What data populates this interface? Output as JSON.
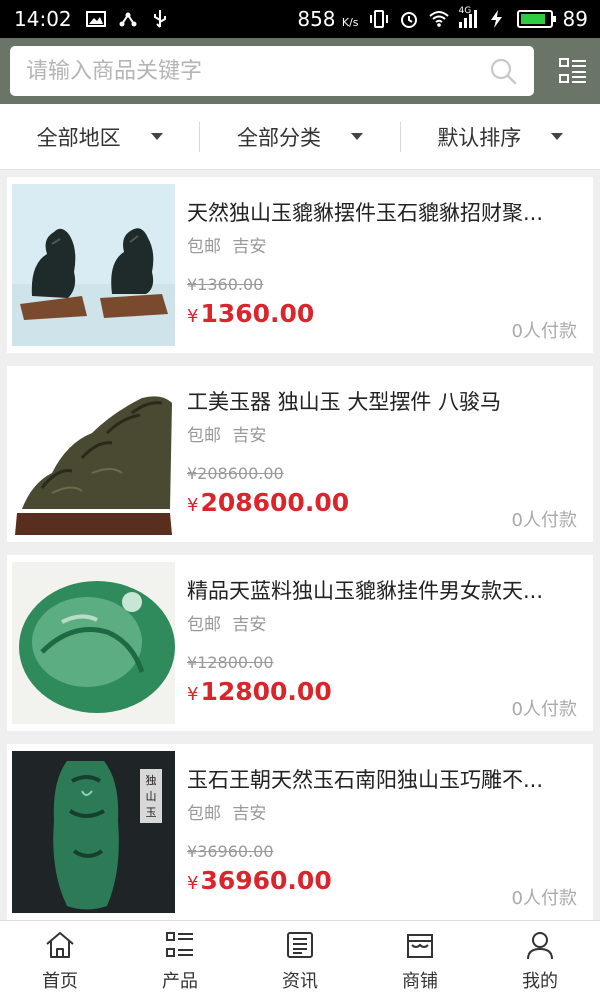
{
  "status": {
    "time": "14:02",
    "speed_value": "858",
    "speed_unit": "K/s",
    "network": "4G",
    "battery": "89",
    "battery_level": 0.89
  },
  "search": {
    "placeholder": "请输入商品关键字",
    "value": ""
  },
  "filters": [
    {
      "label": "全部地区"
    },
    {
      "label": "全部分类"
    },
    {
      "label": "默认排序"
    }
  ],
  "products": [
    {
      "title": "天然独山玉貔貅摆件玉石貔貅招财聚...",
      "shipping": "包邮",
      "location": "吉安",
      "old_price": "¥1360.00",
      "currency": "¥",
      "price": "1360.00",
      "paid": "0人付款"
    },
    {
      "title": "工美玉器 独山玉 大型摆件 八骏马",
      "shipping": "包邮",
      "location": "吉安",
      "old_price": "¥208600.00",
      "currency": "¥",
      "price": "208600.00",
      "paid": "0人付款"
    },
    {
      "title": "精品天蓝料独山玉貔貅挂件男女款天...",
      "shipping": "包邮",
      "location": "吉安",
      "old_price": "¥12800.00",
      "currency": "¥",
      "price": "12800.00",
      "paid": "0人付款"
    },
    {
      "title": "玉石王朝天然玉石南阳独山玉巧雕不...",
      "shipping": "包邮",
      "location": "吉安",
      "old_price": "¥36960.00",
      "currency": "¥",
      "price": "36960.00",
      "paid": "0人付款",
      "image_text": "独山玉"
    }
  ],
  "nav": [
    {
      "label": "首页",
      "icon": "home-icon"
    },
    {
      "label": "产品",
      "icon": "list-icon"
    },
    {
      "label": "资讯",
      "icon": "news-icon"
    },
    {
      "label": "商铺",
      "icon": "shop-icon"
    },
    {
      "label": "我的",
      "icon": "user-icon"
    }
  ],
  "colors": {
    "header_bg": "#6b7567",
    "price_red": "#d9262c"
  }
}
